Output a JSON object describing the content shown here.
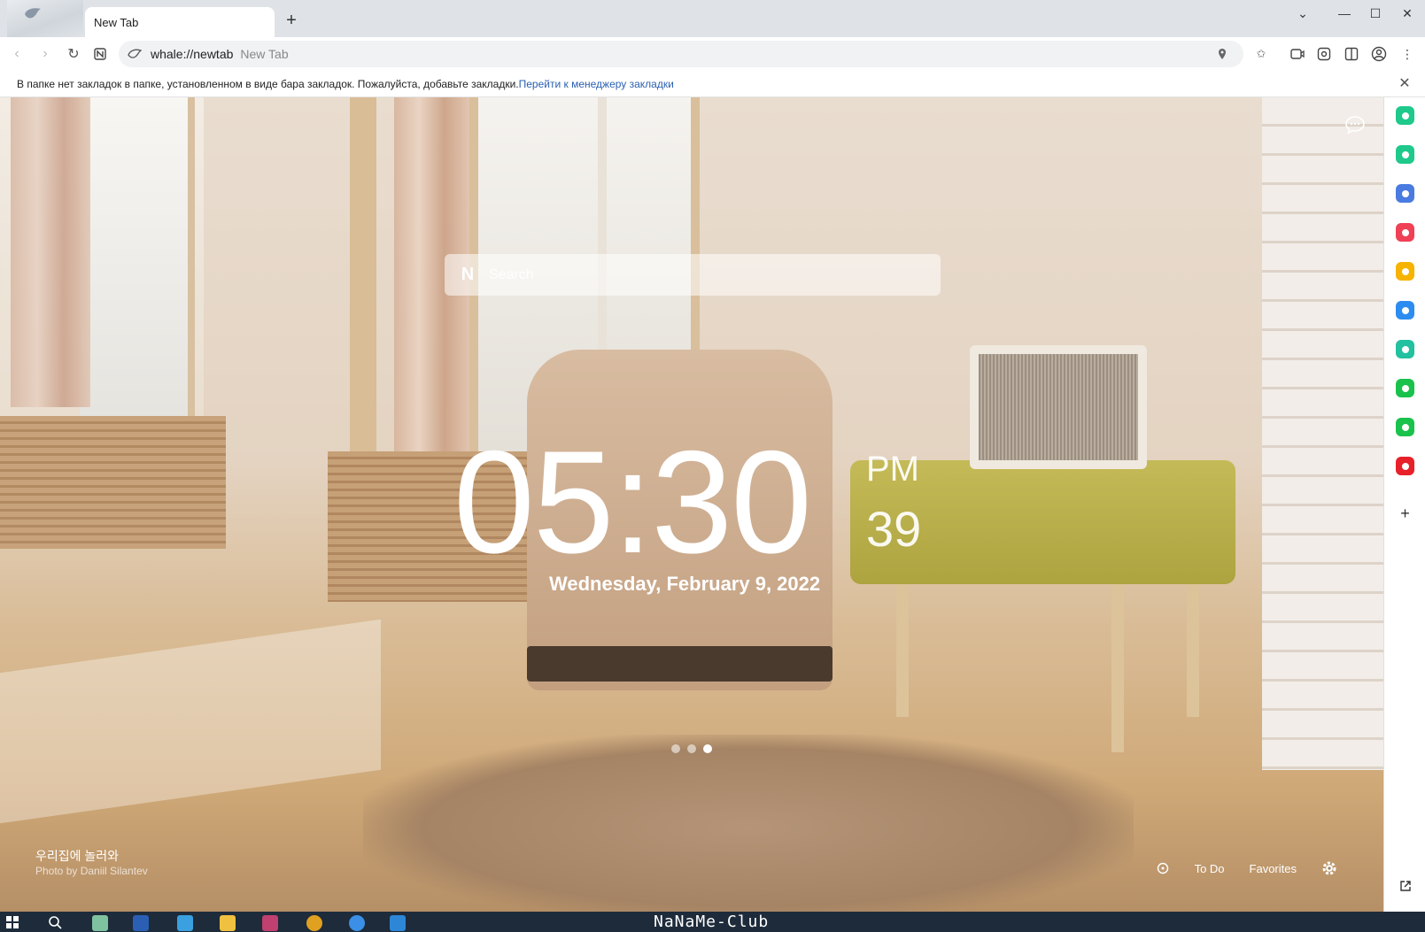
{
  "tab": {
    "title": "New Tab"
  },
  "window": {
    "minimize": "—",
    "maximize": "☐",
    "close": "✕",
    "dropdown": "⌄"
  },
  "address": {
    "url": "whale://newtab",
    "page_title": "New Tab"
  },
  "bookmarks_notice": {
    "text": "В папке нет закладок в папке, установленном в виде бара закладок. Пожалуйста, добавьте закладки.",
    "link": "Перейти к менеджеру закладки"
  },
  "search": {
    "placeholder": "Search",
    "logo": "N"
  },
  "clock": {
    "time": "05:30",
    "ampm": "PM",
    "seconds": "39",
    "date": "Wednesday, February 9, 2022"
  },
  "wallpaper": {
    "title": "우리집에 놀러와",
    "credit": "Photo by Daniil Silantev",
    "slides": 3,
    "active_slide": 3
  },
  "bottom_bar": {
    "todo": "To Do",
    "favorites": "Favorites"
  },
  "sidebar_apps": [
    {
      "name": "green-app-icon",
      "color": "#1ec98b"
    },
    {
      "name": "notification-app-icon",
      "color": "#1ec98b"
    },
    {
      "name": "briefcase-app-icon",
      "color": "#4a7be0"
    },
    {
      "name": "pocket-app-icon",
      "color": "#ef4056"
    },
    {
      "name": "star-app-icon",
      "color": "#f6b300"
    },
    {
      "name": "translate-app-icon",
      "color": "#2d8cf0"
    },
    {
      "name": "play-app-icon",
      "color": "#22c1a0"
    },
    {
      "name": "webtoon-app-icon",
      "color": "#19c24b"
    },
    {
      "name": "square-app-icon",
      "color": "#19c24b"
    },
    {
      "name": "news-app-icon",
      "color": "#e8202a"
    }
  ],
  "taskbar": {
    "watermark": "NaNaMe-Club"
  },
  "colors": {
    "accent": "#2a5fb0",
    "taskbar": "#1d2b3a"
  }
}
